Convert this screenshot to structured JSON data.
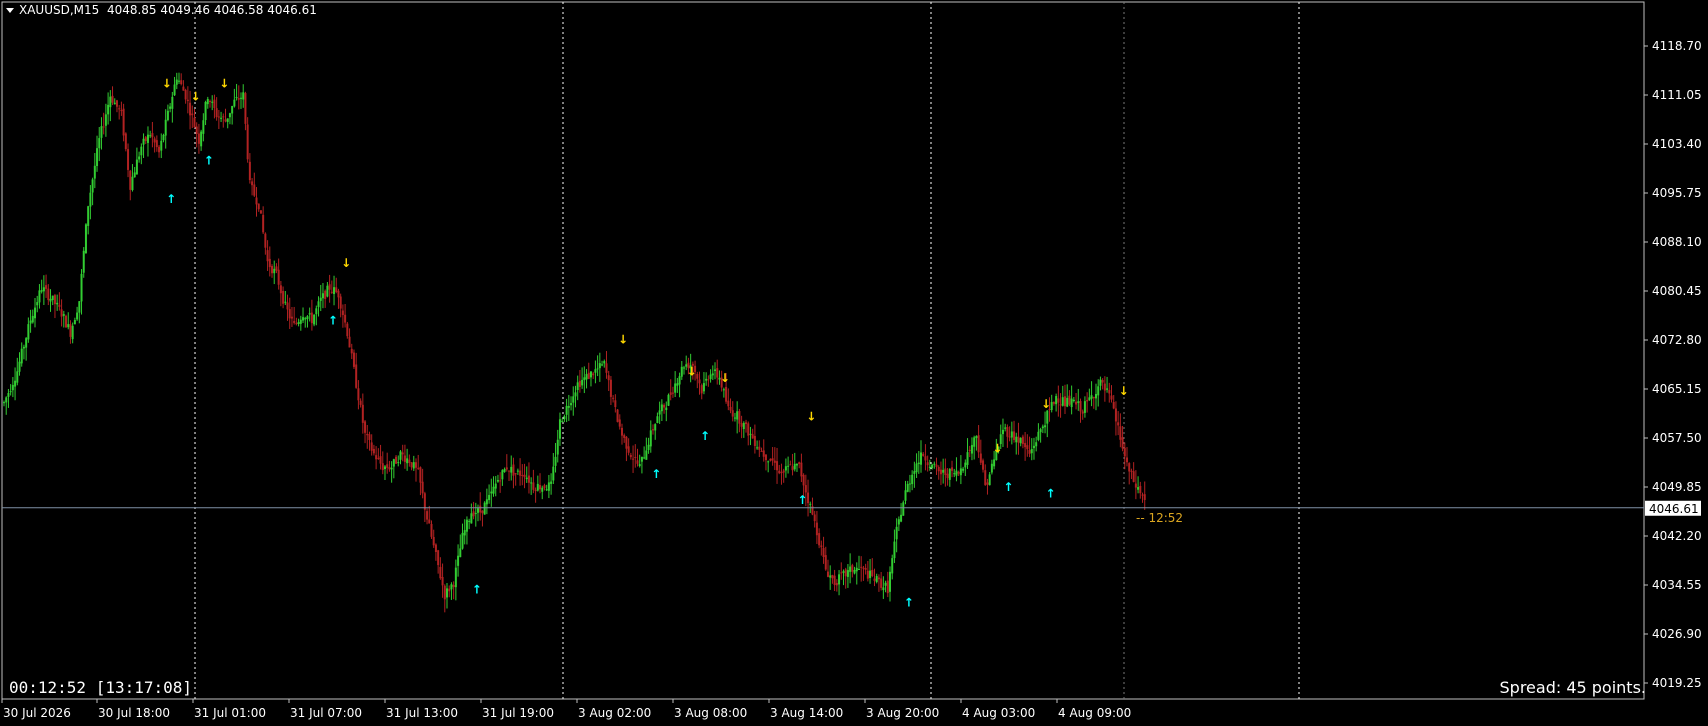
{
  "header": {
    "symbol": "XAUUSD,M15",
    "ohlc": "4048.85 4049.46 4046.58 4046.61"
  },
  "timer": "00:12:52 [13:17:08]",
  "spread": "Spread: 45 points.",
  "countdown": "-- 12:52",
  "current_price": "4046.61",
  "colors": {
    "background": "#000000",
    "bull": "#32CD32",
    "bear": "#B22222",
    "up_arrow": "#00FFFF",
    "down_arrow": "#FFD700",
    "countdown": "#DAA520",
    "grid": "#FFFFFF"
  },
  "chart_data": {
    "type": "candlestick",
    "symbol": "XAUUSD",
    "timeframe": "M15",
    "ylim": [
      4016.0,
      4124.0
    ],
    "y_ticks": [
      "4118.70",
      "4111.05",
      "4103.40",
      "4095.75",
      "4088.10",
      "4080.45",
      "4072.80",
      "4065.15",
      "4057.50",
      "4049.85",
      "4042.20",
      "4034.55",
      "4026.90",
      "4019.25"
    ],
    "x_ticks": [
      "30 Jul 2026",
      "30 Jul 18:00",
      "31 Jul 01:00",
      "31 Jul 07:00",
      "31 Jul 13:00",
      "31 Jul 19:00",
      "3 Aug 02:00",
      "3 Aug 08:00",
      "3 Aug 14:00",
      "3 Aug 20:00",
      "4 Aug 03:00",
      "4 Aug 09:00"
    ],
    "day_separators": [
      "31 Jul 00:00",
      "3 Aug 00:00",
      "4 Aug 00:00",
      "5 Aug 00:00"
    ],
    "current_price": 4046.61,
    "close_path": [
      [
        0,
        4063
      ],
      [
        6,
        4068
      ],
      [
        12,
        4076
      ],
      [
        17,
        4081
      ],
      [
        22,
        4079
      ],
      [
        26,
        4077
      ],
      [
        30,
        4074
      ],
      [
        34,
        4079
      ],
      [
        38,
        4094
      ],
      [
        43,
        4104
      ],
      [
        48,
        4111
      ],
      [
        53,
        4108
      ],
      [
        57,
        4097
      ],
      [
        62,
        4103
      ],
      [
        66,
        4105
      ],
      [
        70,
        4102
      ],
      [
        74,
        4108
      ],
      [
        78,
        4114
      ],
      [
        82,
        4111
      ],
      [
        88,
        4104
      ],
      [
        92,
        4111
      ],
      [
        96,
        4108
      ],
      [
        100,
        4107
      ],
      [
        104,
        4110
      ],
      [
        108,
        4111
      ],
      [
        111,
        4097
      ],
      [
        115,
        4094
      ],
      [
        119,
        4085
      ],
      [
        123,
        4083
      ],
      [
        127,
        4078
      ],
      [
        131,
        4075
      ],
      [
        135,
        4077
      ],
      [
        139,
        4076
      ],
      [
        143,
        4079
      ],
      [
        147,
        4081
      ],
      [
        151,
        4080
      ],
      [
        155,
        4074
      ],
      [
        159,
        4066
      ],
      [
        163,
        4058
      ],
      [
        167,
        4055
      ],
      [
        171,
        4053
      ],
      [
        175,
        4053
      ],
      [
        179,
        4055
      ],
      [
        183,
        4054
      ],
      [
        187,
        4052
      ],
      [
        191,
        4045
      ],
      [
        195,
        4039
      ],
      [
        199,
        4033
      ],
      [
        203,
        4035
      ],
      [
        207,
        4042
      ],
      [
        211,
        4046
      ],
      [
        215,
        4046
      ],
      [
        219,
        4048
      ],
      [
        223,
        4051
      ],
      [
        227,
        4053
      ],
      [
        231,
        4052
      ],
      [
        235,
        4052
      ],
      [
        239,
        4050
      ],
      [
        243,
        4050
      ],
      [
        247,
        4050
      ],
      [
        251,
        4060
      ],
      [
        255,
        4063
      ],
      [
        259,
        4066
      ],
      [
        263,
        4067
      ],
      [
        267,
        4068
      ],
      [
        271,
        4069
      ],
      [
        275,
        4063
      ],
      [
        279,
        4058
      ],
      [
        283,
        4055
      ],
      [
        287,
        4053
      ],
      [
        291,
        4057
      ],
      [
        295,
        4061
      ],
      [
        299,
        4063
      ],
      [
        303,
        4066
      ],
      [
        307,
        4069
      ],
      [
        311,
        4069
      ],
      [
        315,
        4065
      ],
      [
        319,
        4068
      ],
      [
        323,
        4067
      ],
      [
        327,
        4062
      ],
      [
        331,
        4061
      ],
      [
        335,
        4059
      ],
      [
        339,
        4057
      ],
      [
        343,
        4055
      ],
      [
        347,
        4054
      ],
      [
        351,
        4052
      ],
      [
        355,
        4053
      ],
      [
        359,
        4053
      ],
      [
        363,
        4048
      ],
      [
        367,
        4043
      ],
      [
        371,
        4037
      ],
      [
        375,
        4035
      ],
      [
        379,
        4036
      ],
      [
        383,
        4037
      ],
      [
        387,
        4037
      ],
      [
        391,
        4036
      ],
      [
        395,
        4035
      ],
      [
        399,
        4034
      ],
      [
        403,
        4043
      ],
      [
        407,
        4049
      ],
      [
        411,
        4053
      ],
      [
        415,
        4055
      ],
      [
        419,
        4053
      ],
      [
        423,
        4052
      ],
      [
        427,
        4052
      ],
      [
        431,
        4052
      ],
      [
        435,
        4055
      ],
      [
        439,
        4058
      ],
      [
        443,
        4050
      ],
      [
        447,
        4054
      ],
      [
        451,
        4059
      ],
      [
        455,
        4058
      ],
      [
        459,
        4057
      ],
      [
        463,
        4055
      ],
      [
        467,
        4058
      ],
      [
        471,
        4061
      ],
      [
        475,
        4064
      ],
      [
        479,
        4063
      ],
      [
        483,
        4063
      ],
      [
        487,
        4062
      ],
      [
        491,
        4064
      ],
      [
        495,
        4066
      ],
      [
        499,
        4064
      ],
      [
        503,
        4059
      ],
      [
        507,
        4053
      ],
      [
        511,
        4050
      ],
      [
        515,
        4048
      ]
    ],
    "arrows": [
      {
        "dir": "down",
        "bar": 73,
        "price": 4113
      },
      {
        "dir": "down",
        "bar": 86,
        "price": 4111
      },
      {
        "dir": "down",
        "bar": 99,
        "price": 4113
      },
      {
        "dir": "up",
        "bar": 75,
        "price": 4095
      },
      {
        "dir": "up",
        "bar": 92,
        "price": 4101
      },
      {
        "dir": "down",
        "bar": 154,
        "price": 4085
      },
      {
        "dir": "up",
        "bar": 148,
        "price": 4076
      },
      {
        "dir": "up",
        "bar": 213,
        "price": 4034
      },
      {
        "dir": "down",
        "bar": 279,
        "price": 4073
      },
      {
        "dir": "up",
        "bar": 294,
        "price": 4052
      },
      {
        "dir": "down",
        "bar": 310,
        "price": 4068
      },
      {
        "dir": "down",
        "bar": 325,
        "price": 4067
      },
      {
        "dir": "up",
        "bar": 316,
        "price": 4058
      },
      {
        "dir": "up",
        "bar": 360,
        "price": 4048
      },
      {
        "dir": "down",
        "bar": 364,
        "price": 4061
      },
      {
        "dir": "up",
        "bar": 408,
        "price": 4032
      },
      {
        "dir": "down",
        "bar": 448,
        "price": 4056
      },
      {
        "dir": "up",
        "bar": 453,
        "price": 4050
      },
      {
        "dir": "down",
        "bar": 470,
        "price": 4063
      },
      {
        "dir": "up",
        "bar": 472,
        "price": 4049
      },
      {
        "dir": "down",
        "bar": 505,
        "price": 4065
      }
    ]
  }
}
